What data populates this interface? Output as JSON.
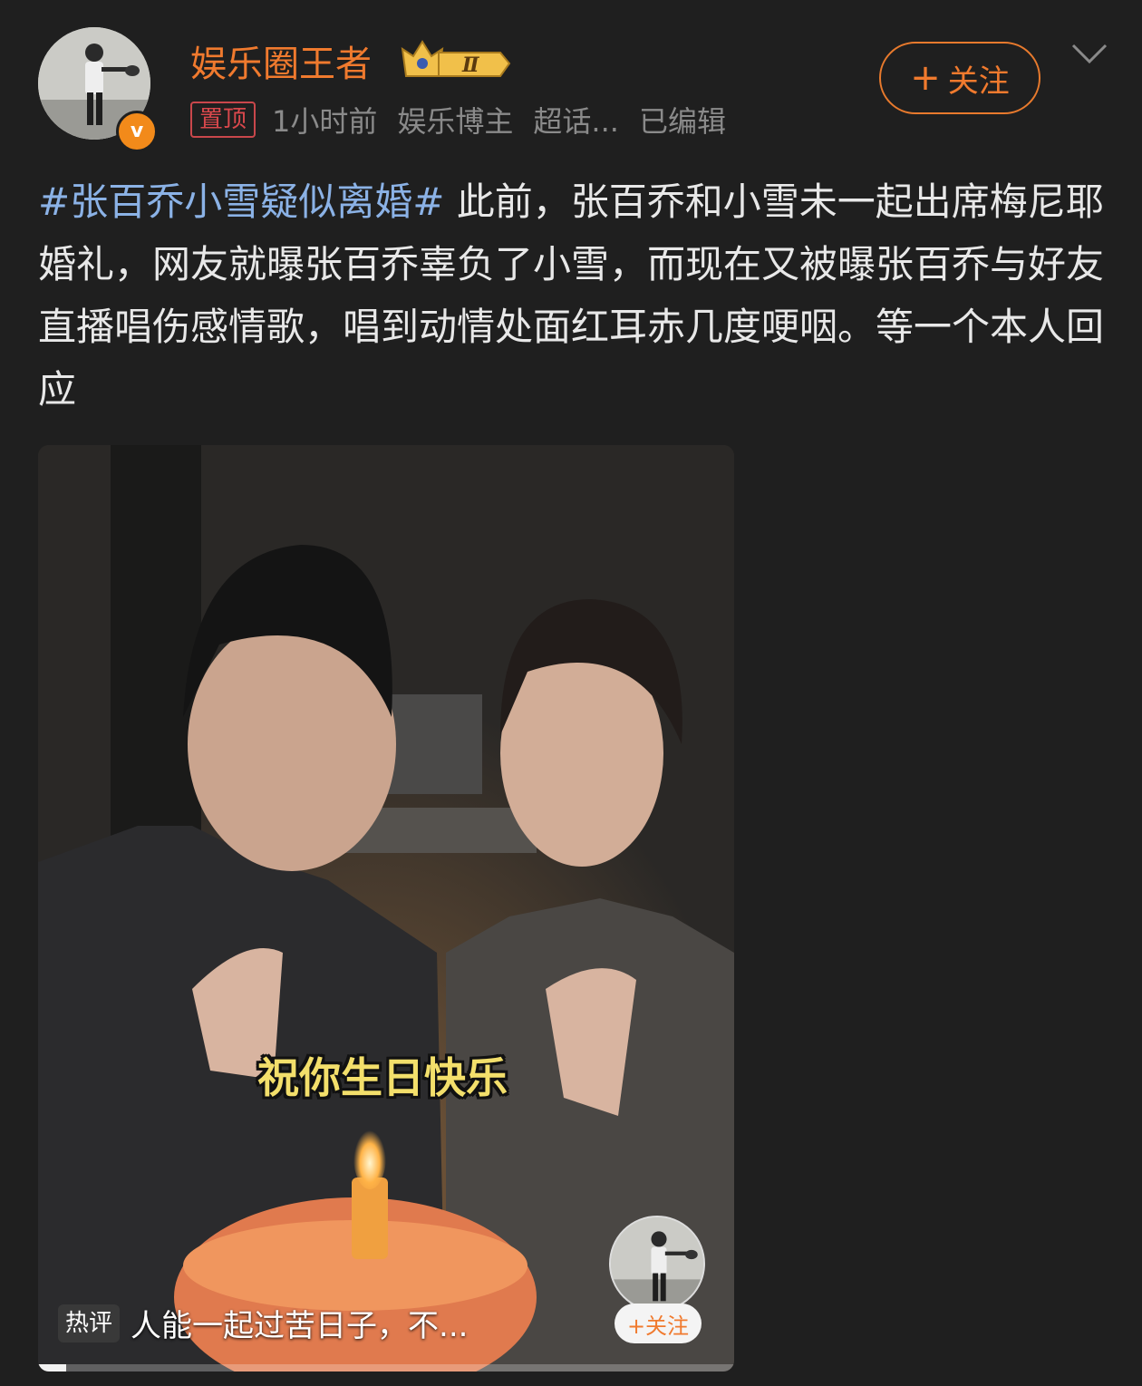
{
  "header": {
    "username": "娱乐圈王者",
    "level_badge": "Ⅱ",
    "verified_badge": "v",
    "pinned_tag": "置顶",
    "time": "1小时前",
    "category": "娱乐博主",
    "supertopic": "超话...",
    "edited": "已编辑",
    "follow_label": "关注",
    "follow_plus": "+",
    "accent_color": "#f07a2e"
  },
  "post": {
    "hashtag": "#张百乔小雪疑似离婚#",
    "body": " 此前，张百乔和小雪未一起出席梅尼耶婚礼，网友就曝张百乔辜负了小雪，而现在又被曝张百乔与好友直播唱伤感情歌，唱到动情处面红耳赤几度哽咽。等一个本人回应"
  },
  "video": {
    "subtitle": "祝你生日快乐",
    "hot_comment_tag": "热评",
    "hot_comment": "人能一起过苦日子，不...",
    "mini_follow_label": "+关注",
    "progress": 0.04
  }
}
